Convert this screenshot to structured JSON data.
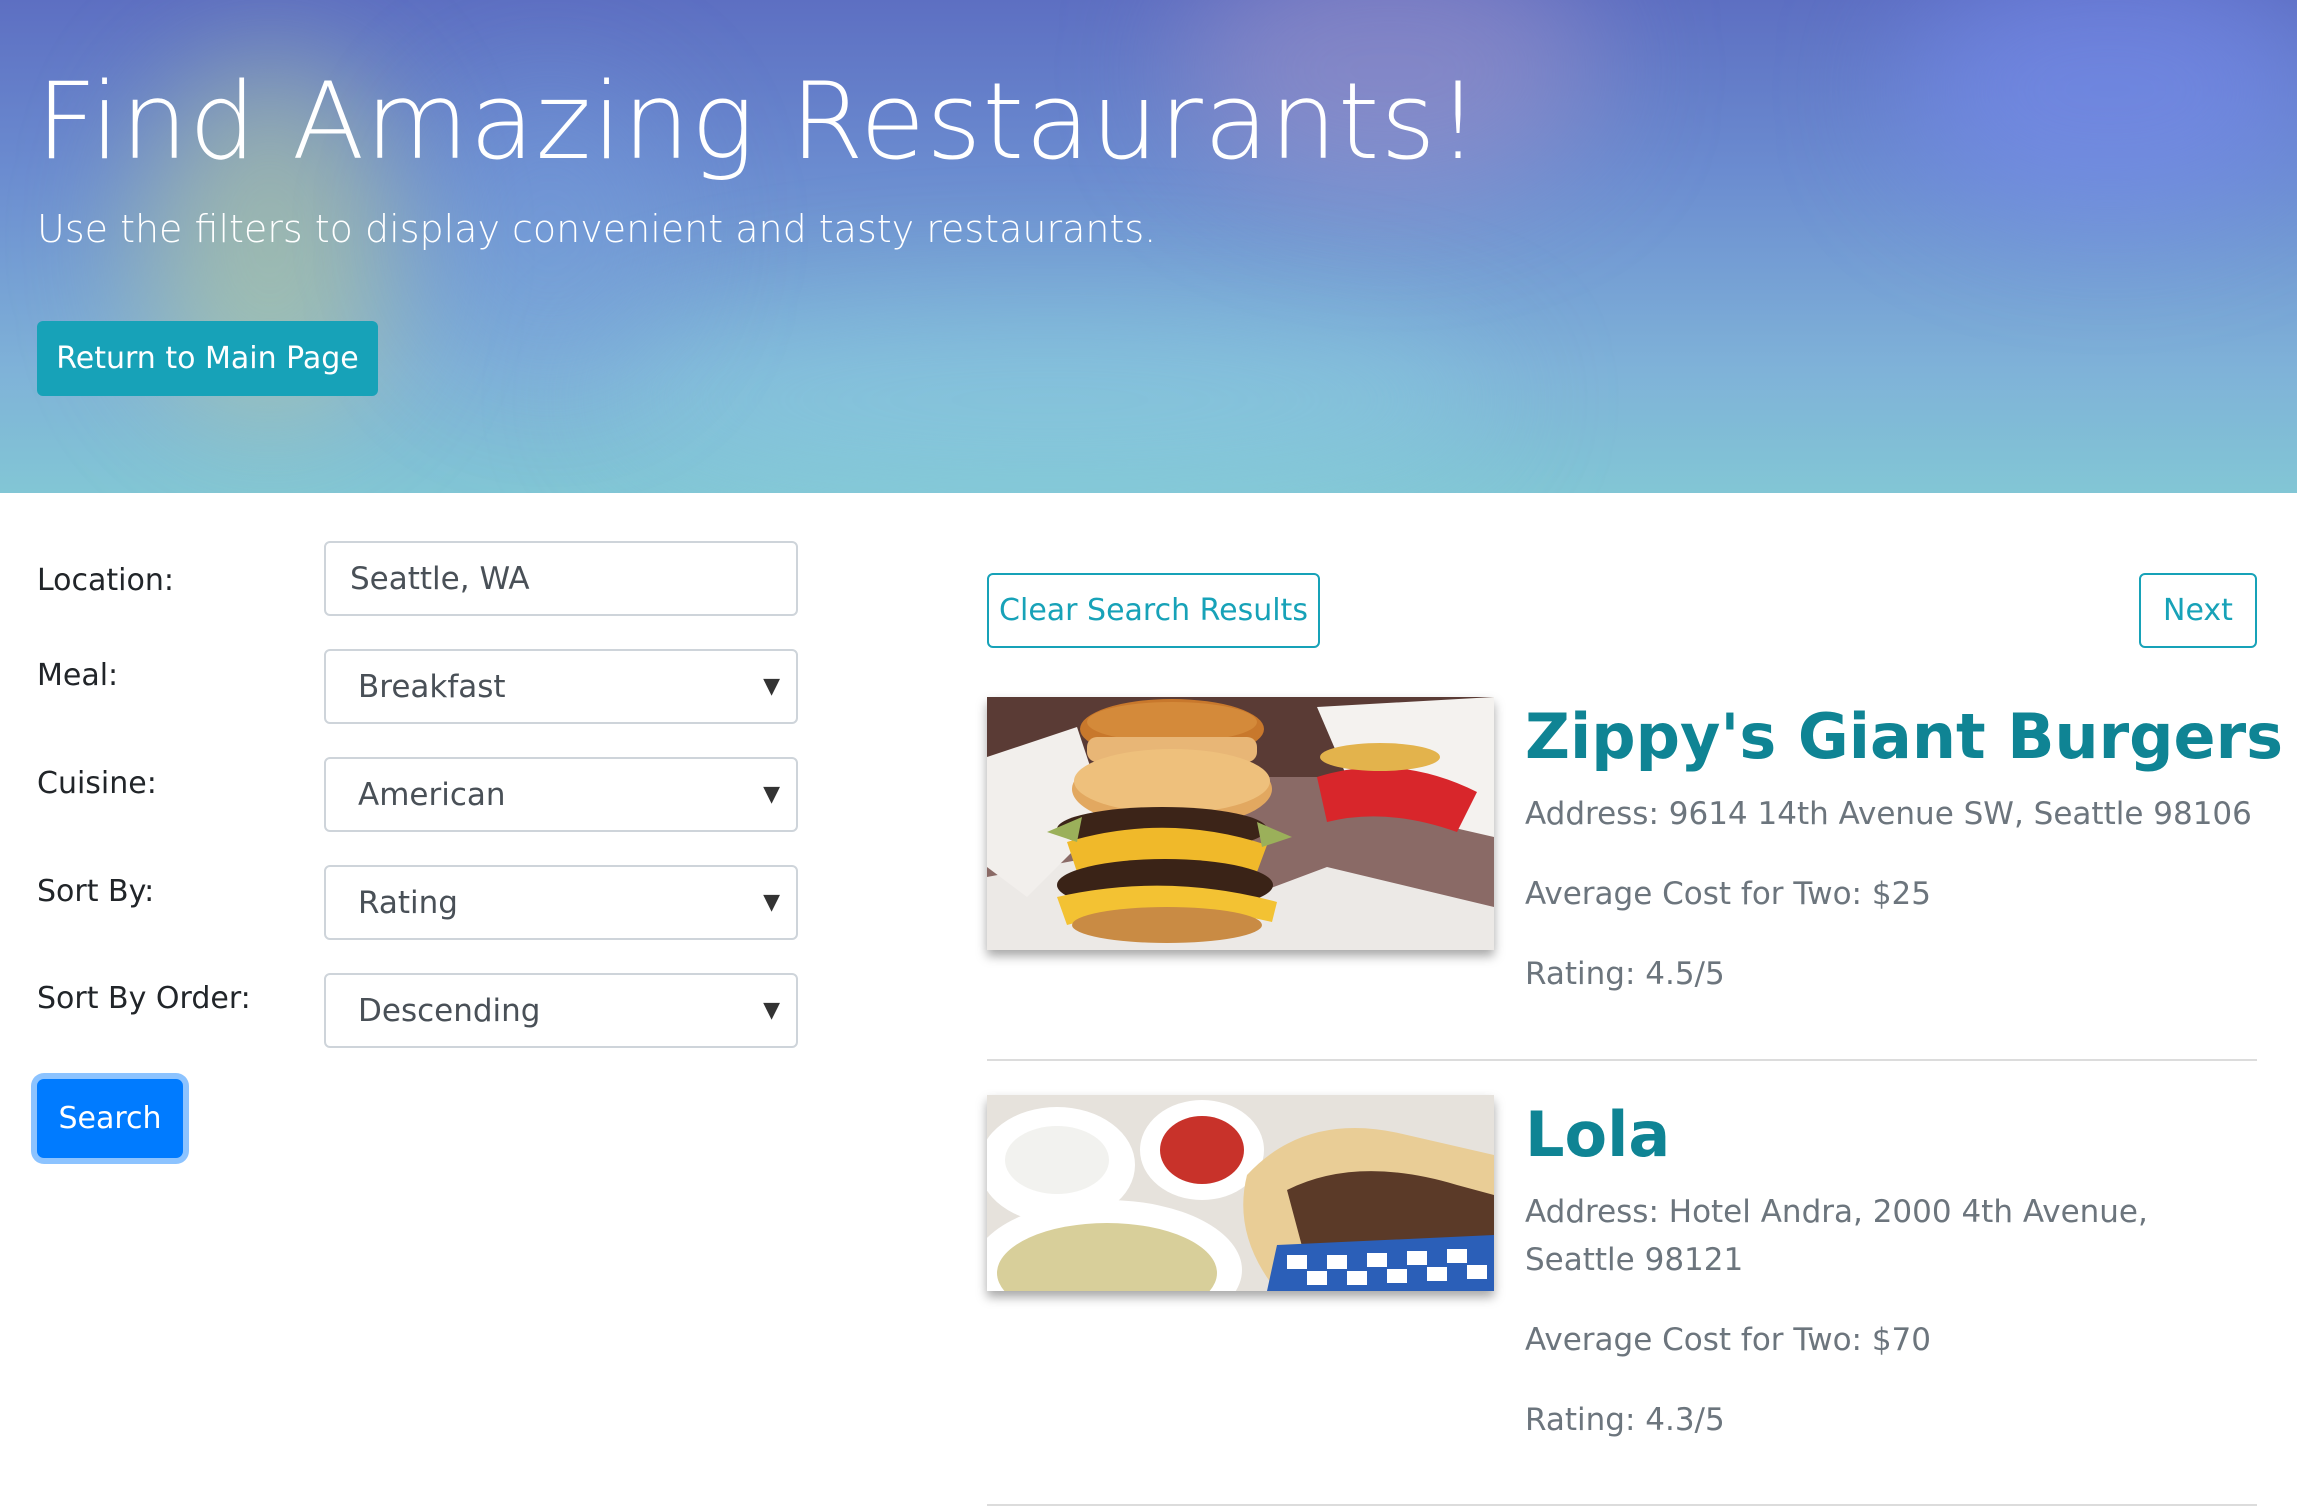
{
  "hero": {
    "title": "Find Amazing Restaurants!",
    "subtitle": "Use the filters to display convenient and tasty restaurants.",
    "return_button": "Return to Main Page"
  },
  "filters": {
    "location_label": "Location:",
    "location_value": "Seattle, WA",
    "meal_label": "Meal:",
    "meal_value": "Breakfast",
    "cuisine_label": "Cuisine:",
    "cuisine_value": "American",
    "sort_by_label": "Sort By:",
    "sort_by_value": "Rating",
    "sort_order_label": "Sort By Order:",
    "sort_order_value": "Descending",
    "search_button": "Search"
  },
  "results": {
    "clear_button": "Clear Search Results",
    "next_button": "Next",
    "items": [
      {
        "name": "Zippy's Giant Burgers",
        "address": "Address: 9614 14th Avenue SW, Seattle 98106",
        "cost": "Average Cost for Two: $25",
        "rating": "Rating: 4.5/5"
      },
      {
        "name": "Lola",
        "address": "Address: Hotel Andra, 2000 4th Avenue, Seattle 98121",
        "cost": "Average Cost for Two: $70",
        "rating": "Rating: 4.3/5"
      }
    ]
  },
  "icons": {
    "select_caret": "caret-down-icon"
  },
  "colors": {
    "info": "#17a2b8",
    "primary": "#007bff",
    "restaurant_name": "#0f8494",
    "muted_text": "#6c757d"
  }
}
